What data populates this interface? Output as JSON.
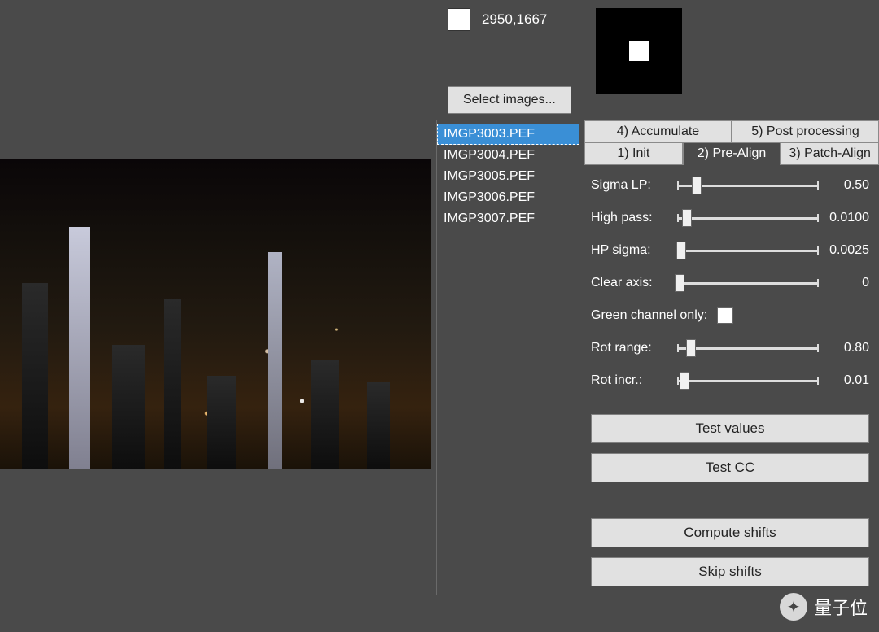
{
  "coords": "2950,1667",
  "select_images_label": "Select images...",
  "files": [
    {
      "name": "IMGP3003.PEF",
      "selected": true
    },
    {
      "name": "IMGP3004.PEF",
      "selected": false
    },
    {
      "name": "IMGP3005.PEF",
      "selected": false
    },
    {
      "name": "IMGP3006.PEF",
      "selected": false
    },
    {
      "name": "IMGP3007.PEF",
      "selected": false
    }
  ],
  "tabs_top": [
    {
      "label": "4) Accumulate"
    },
    {
      "label": "5) Post processing"
    }
  ],
  "tabs_bottom": [
    {
      "label": "1) Init",
      "active": false
    },
    {
      "label": "2) Pre-Align",
      "active": true
    },
    {
      "label": "3) Patch-Align",
      "active": false
    }
  ],
  "sliders": {
    "sigma_lp": {
      "label": "Sigma LP:",
      "value": "0.50",
      "pos": 14
    },
    "high_pass": {
      "label": "High pass:",
      "value": "0.0100",
      "pos": 7
    },
    "hp_sigma": {
      "label": "HP sigma:",
      "value": "0.0025",
      "pos": 3
    },
    "clear_axis": {
      "label": "Clear axis:",
      "value": "0",
      "pos": 2
    },
    "rot_range": {
      "label": "Rot range:",
      "value": "0.80",
      "pos": 10
    },
    "rot_incr": {
      "label": "Rot incr.:",
      "value": "0.01",
      "pos": 5
    }
  },
  "green_channel_label": "Green channel only:",
  "green_channel_checked": false,
  "buttons": {
    "test_values": "Test values",
    "test_cc": "Test CC",
    "compute_shifts": "Compute shifts",
    "skip_shifts": "Skip shifts"
  },
  "watermark": "量子位"
}
